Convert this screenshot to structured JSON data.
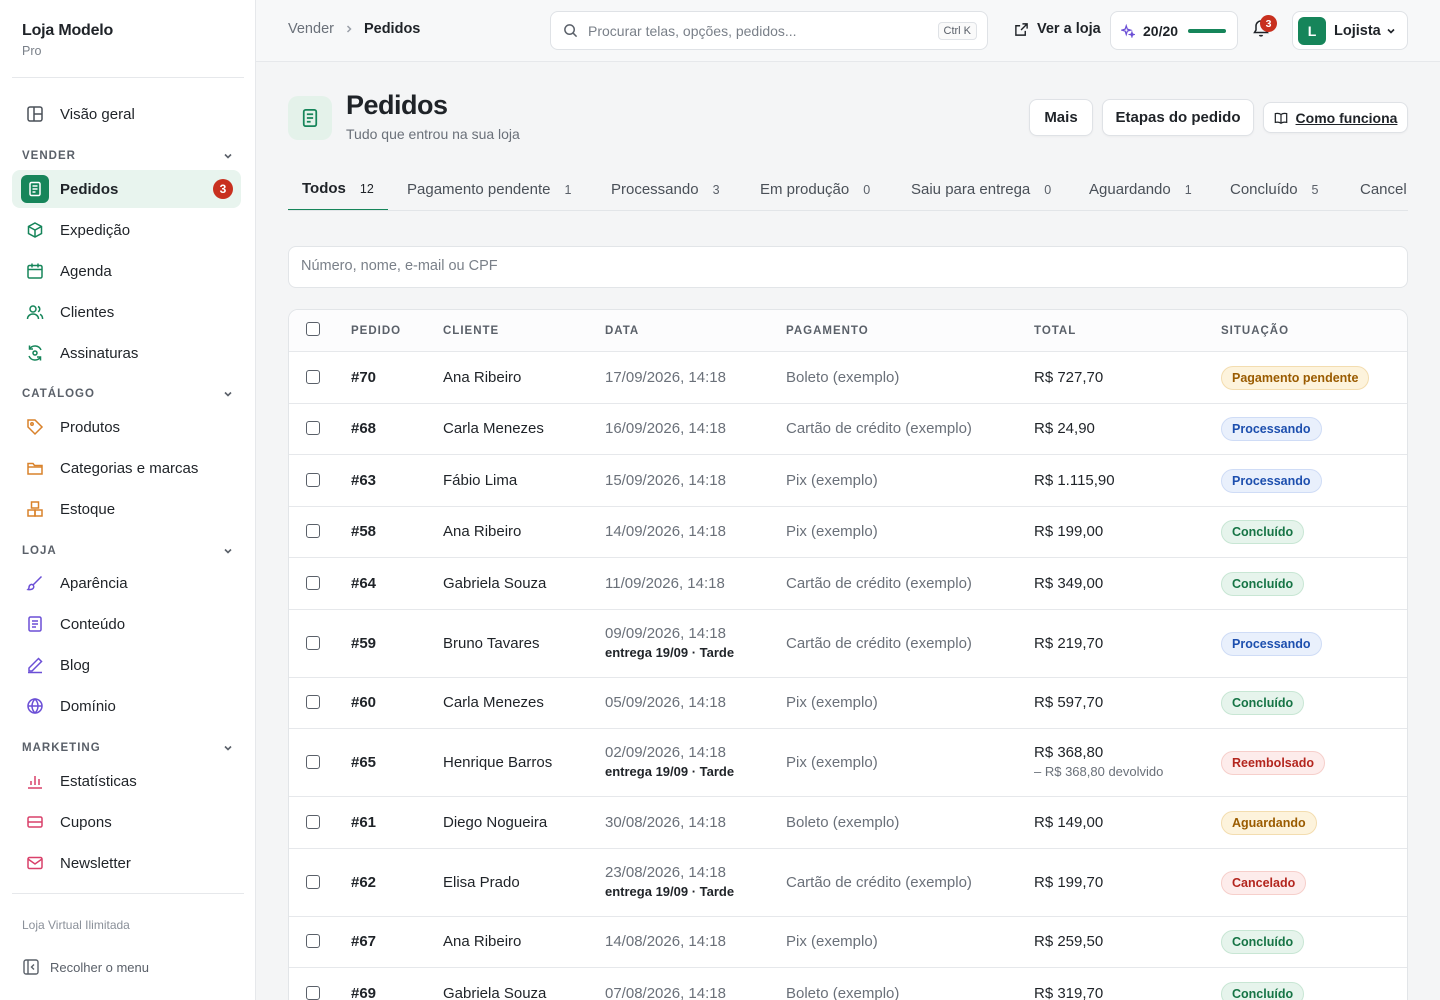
{
  "brand": {
    "name": "Loja Modelo",
    "plan": "Pro"
  },
  "sidebar": {
    "overview": "Visão geral",
    "sections": {
      "vender": "VENDER",
      "catalogo": "CATÁLOGO",
      "loja": "LOJA",
      "marketing": "MARKETING"
    },
    "items": {
      "pedidos": "Pedidos",
      "pedidos_badge": "3",
      "expedicao": "Expedição",
      "agenda": "Agenda",
      "clientes": "Clientes",
      "assinaturas": "Assinaturas",
      "produtos": "Produtos",
      "categorias": "Categorias e marcas",
      "estoque": "Estoque",
      "aparencia": "Aparência",
      "conteudo": "Conteúdo",
      "blog": "Blog",
      "dominio": "Domínio",
      "estatisticas": "Estatísticas",
      "cupons": "Cupons",
      "newsletter": "Newsletter"
    },
    "footer": "Loja Virtual Ilimitada",
    "collapse": "Recolher o menu",
    "icon_color": "#16855a",
    "accent_orange": "#d9822b",
    "accent_purple": "#6b4fd6",
    "accent_pink": "#d9406a"
  },
  "topbar": {
    "breadcrumb": [
      "Vender",
      "Pedidos"
    ],
    "search_placeholder": "Procurar telas, opções, pedidos...",
    "shortcut": "Ctrl K",
    "view_store": "Ver a loja",
    "quota": "20/20",
    "quota_fraction": 1.0,
    "notifications": "3",
    "user_initial": "L",
    "user_name": "Lojista"
  },
  "header": {
    "title": "Pedidos",
    "subtitle": "Tudo que entrou na sua loja",
    "btn_more": "Mais",
    "btn_steps": "Etapas do pedido",
    "btn_how": "Como funciona"
  },
  "tabs": [
    {
      "label": "Todos",
      "count": "12"
    },
    {
      "label": "Pagamento pendente",
      "count": "1"
    },
    {
      "label": "Processando",
      "count": "3"
    },
    {
      "label": "Em produção",
      "count": "0"
    },
    {
      "label": "Saiu para entrega",
      "count": "0"
    },
    {
      "label": "Aguardando",
      "count": "1"
    },
    {
      "label": "Concluído",
      "count": "5"
    },
    {
      "label": "Cancel",
      "count": ""
    }
  ],
  "filter_placeholder": "Número, nome, e-mail ou CPF",
  "table": {
    "columns": [
      "PEDIDO",
      "CLIENTE",
      "DATA",
      "PAGAMENTO",
      "TOTAL",
      "SITUAÇÃO"
    ],
    "rows": [
      {
        "num": "#70",
        "client": "Ana Ribeiro",
        "date": "17/09/2026, 14:18",
        "date_sub": "",
        "payment": "Boleto (exemplo)",
        "total": "R$ 727,70",
        "total_sub": "",
        "status": "Pagamento pendente",
        "tone": "amber"
      },
      {
        "num": "#68",
        "client": "Carla Menezes",
        "date": "16/09/2026, 14:18",
        "date_sub": "",
        "payment": "Cartão de crédito (exemplo)",
        "total": "R$ 24,90",
        "total_sub": "",
        "status": "Processando",
        "tone": "blue"
      },
      {
        "num": "#63",
        "client": "Fábio Lima",
        "date": "15/09/2026, 14:18",
        "date_sub": "",
        "payment": "Pix (exemplo)",
        "total": "R$ 1.115,90",
        "total_sub": "",
        "status": "Processando",
        "tone": "blue"
      },
      {
        "num": "#58",
        "client": "Ana Ribeiro",
        "date": "14/09/2026, 14:18",
        "date_sub": "",
        "payment": "Pix (exemplo)",
        "total": "R$ 199,00",
        "total_sub": "",
        "status": "Concluído",
        "tone": "green"
      },
      {
        "num": "#64",
        "client": "Gabriela Souza",
        "date": "11/09/2026, 14:18",
        "date_sub": "",
        "payment": "Cartão de crédito (exemplo)",
        "total": "R$ 349,00",
        "total_sub": "",
        "status": "Concluído",
        "tone": "green"
      },
      {
        "num": "#59",
        "client": "Bruno Tavares",
        "date": "09/09/2026, 14:18",
        "date_sub": "entrega 19/09 · Tarde",
        "payment": "Cartão de crédito (exemplo)",
        "total": "R$ 219,70",
        "total_sub": "",
        "status": "Processando",
        "tone": "blue"
      },
      {
        "num": "#60",
        "client": "Carla Menezes",
        "date": "05/09/2026, 14:18",
        "date_sub": "",
        "payment": "Pix (exemplo)",
        "total": "R$ 597,70",
        "total_sub": "",
        "status": "Concluído",
        "tone": "green"
      },
      {
        "num": "#65",
        "client": "Henrique Barros",
        "date": "02/09/2026, 14:18",
        "date_sub": "entrega 19/09 · Tarde",
        "payment": "Pix (exemplo)",
        "total": "R$ 368,80",
        "total_sub": "– R$ 368,80 devolvido",
        "status": "Reembolsado",
        "tone": "red"
      },
      {
        "num": "#61",
        "client": "Diego Nogueira",
        "date": "30/08/2026, 14:18",
        "date_sub": "",
        "payment": "Boleto (exemplo)",
        "total": "R$ 149,00",
        "total_sub": "",
        "status": "Aguardando",
        "tone": "amber"
      },
      {
        "num": "#62",
        "client": "Elisa Prado",
        "date": "23/08/2026, 14:18",
        "date_sub": "entrega 19/09 · Tarde",
        "payment": "Cartão de crédito (exemplo)",
        "total": "R$ 199,70",
        "total_sub": "",
        "status": "Cancelado",
        "tone": "red"
      },
      {
        "num": "#67",
        "client": "Ana Ribeiro",
        "date": "14/08/2026, 14:18",
        "date_sub": "",
        "payment": "Pix (exemplo)",
        "total": "R$ 259,50",
        "total_sub": "",
        "status": "Concluído",
        "tone": "green"
      },
      {
        "num": "#69",
        "client": "Gabriela Souza",
        "date": "07/08/2026, 14:18",
        "date_sub": "",
        "payment": "Boleto (exemplo)",
        "total": "R$ 319,70",
        "total_sub": "",
        "status": "Concluído",
        "tone": "green"
      }
    ]
  },
  "tones": {
    "amber": {
      "bg": "#fdf3dc",
      "border": "#f3ddb0",
      "fg": "#9a5b00"
    },
    "blue": {
      "bg": "#e9f0fc",
      "border": "#cfdcf6",
      "fg": "#1d4fae"
    },
    "green": {
      "bg": "#e6f4ec",
      "border": "#c8e6d4",
      "fg": "#167445"
    },
    "red": {
      "bg": "#fdeceb",
      "border": "#f6cfcb",
      "fg": "#b3261e"
    }
  }
}
